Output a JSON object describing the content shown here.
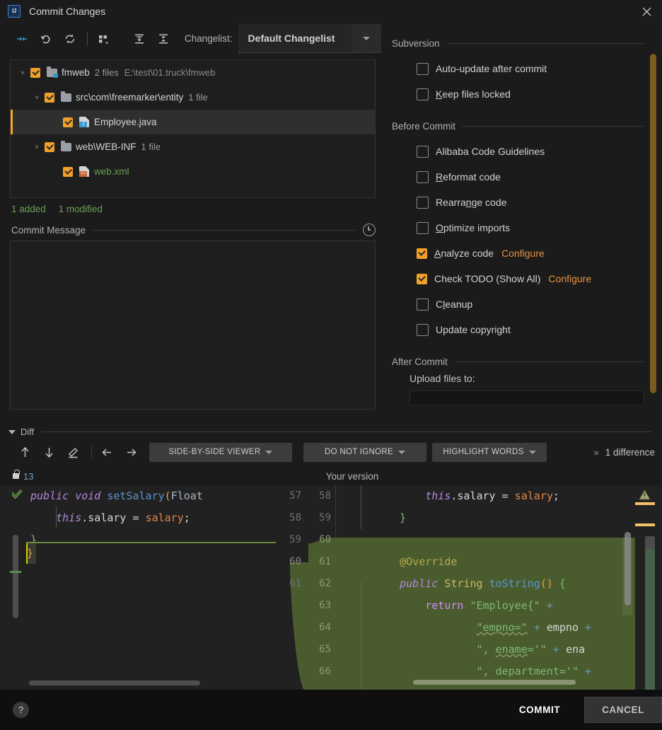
{
  "window": {
    "app_icon": "IJ",
    "title": "Commit Changes",
    "close_icon": "close-icon"
  },
  "toolbar": {
    "icons": [
      {
        "name": "collapse-selection-icon",
        "glyph": "→←"
      },
      {
        "name": "revert-icon",
        "glyph": "↶"
      },
      {
        "name": "refresh-icon",
        "glyph": "↻"
      },
      {
        "name": "group-by-icon",
        "glyph": "▦"
      },
      {
        "name": "expand-all-icon",
        "glyph": "⤓"
      },
      {
        "name": "collapse-all-icon",
        "glyph": "⤒"
      }
    ],
    "changelist_label": "Changelist:",
    "changelist_value": "Default Changelist",
    "changelist_caret": "chevron-down-icon"
  },
  "tree": {
    "rows": [
      {
        "indent": 1,
        "twisty": "˅",
        "checked": true,
        "icon": "folder-badge-icon",
        "name": "fmweb",
        "meta": "2 files",
        "path": "E:\\test\\01.truck\\fmweb",
        "selected": false,
        "green": false
      },
      {
        "indent": 2,
        "twisty": "˅",
        "checked": true,
        "icon": "folder-icon",
        "name": "src\\com\\freemarker\\entity",
        "meta": "1 file",
        "path": "",
        "selected": false,
        "green": false
      },
      {
        "indent": 3,
        "twisty": "",
        "checked": true,
        "icon": "java-file-icon",
        "name": "Employee.java",
        "meta": "",
        "path": "",
        "selected": true,
        "green": false
      },
      {
        "indent": 2,
        "twisty": "˅",
        "checked": true,
        "icon": "folder-icon",
        "name": "web\\WEB-INF",
        "meta": "1 file",
        "path": "",
        "selected": false,
        "green": false
      },
      {
        "indent": 3,
        "twisty": "",
        "checked": true,
        "icon": "xml-file-icon",
        "name": "web.xml",
        "meta": "",
        "path": "",
        "selected": false,
        "green": true
      }
    ],
    "summary_added": "1 added",
    "summary_modified": "1 modified"
  },
  "commit_message": {
    "label": "Commit Message",
    "history_icon": "history-clock-icon",
    "value": ""
  },
  "options": {
    "subversion": {
      "title": "Subversion",
      "items": [
        {
          "label": "Auto-update after commit",
          "checked": false,
          "mnemonic": "",
          "link": ""
        },
        {
          "label": "Keep files locked",
          "checked": false,
          "mnemonic": "K",
          "link": ""
        }
      ]
    },
    "before_commit": {
      "title": "Before Commit",
      "items": [
        {
          "label": "Alibaba Code Guidelines",
          "checked": false,
          "mnemonic": "",
          "link": ""
        },
        {
          "label": "Reformat code",
          "checked": false,
          "mnemonic": "R",
          "link": ""
        },
        {
          "label": "Rearrange code",
          "checked": false,
          "mnemonic": "n",
          "link": ""
        },
        {
          "label": "Optimize imports",
          "checked": false,
          "mnemonic": "O",
          "link": ""
        },
        {
          "label": "Analyze code",
          "checked": true,
          "mnemonic": "A",
          "link": "Configure"
        },
        {
          "label": "Check TODO (Show All)",
          "checked": true,
          "mnemonic": "",
          "link": "Configure"
        },
        {
          "label": "Cleanup",
          "checked": false,
          "mnemonic": "l",
          "link": ""
        },
        {
          "label": "Update copyright",
          "checked": false,
          "mnemonic": "",
          "link": ""
        }
      ]
    },
    "after_commit": {
      "title": "After Commit",
      "upload_label": "Upload files to:",
      "upload_value": ""
    }
  },
  "diff": {
    "section_label": "Diff",
    "toolbar": {
      "icons": [
        {
          "name": "previous-difference-icon",
          "glyph": "↑"
        },
        {
          "name": "next-difference-icon",
          "glyph": "↓"
        },
        {
          "name": "edit-source-icon",
          "glyph": "✎"
        },
        {
          "name": "apply-left-icon",
          "glyph": "←"
        },
        {
          "name": "apply-right-icon",
          "glyph": "→"
        }
      ],
      "viewer_mode": "SIDE-BY-SIDE VIEWER",
      "ignore_mode": "DO NOT IGNORE",
      "highlight_mode": "HIGHLIGHT WORDS",
      "more_icon": "»",
      "difference_count": "1 difference"
    },
    "left_revision": "13",
    "left_lock_icon": "lock-icon",
    "right_title": "Your version",
    "left_lines": [
      {
        "num": "57",
        "text": "    public void setSalary(Float",
        "changed": false
      },
      {
        "num": "58",
        "text": "        this.salary = salary;",
        "changed": false
      },
      {
        "num": "59",
        "text": "    }",
        "changed": false
      },
      {
        "num": "60",
        "text": "}",
        "changed": true
      },
      {
        "num": "61",
        "text": "",
        "changed": false
      }
    ],
    "right_lines": [
      {
        "num": "58",
        "text": "        this.salary = salary;",
        "added": false
      },
      {
        "num": "59",
        "text": "    }",
        "added": false
      },
      {
        "num": "60",
        "text": "",
        "added": true
      },
      {
        "num": "61",
        "text": "    @Override",
        "added": true
      },
      {
        "num": "62",
        "text": "    public String toString() {",
        "added": true
      },
      {
        "num": "63",
        "text": "        return \"Employee{\" +",
        "added": true
      },
      {
        "num": "64",
        "text": "                \"empno=\" + empno +",
        "added": true
      },
      {
        "num": "65",
        "text": "                \", ename='\" + ename",
        "added": true
      },
      {
        "num": "66",
        "text": "                \", department='\" +",
        "added": true
      }
    ],
    "gutter_marker_icon": "breakpoint-and-arrow-icon",
    "warning_icon": "warning-triangle-icon"
  },
  "footer": {
    "help_label": "?",
    "commit_label": "COMMIT",
    "cancel_label": "CANCEL"
  },
  "colors": {
    "accent_orange": "#f0a029",
    "link_orange": "#e8933a",
    "added_green": "#4a5c2e",
    "selection": "#2f2f2f",
    "background": "#1b1b1b"
  }
}
